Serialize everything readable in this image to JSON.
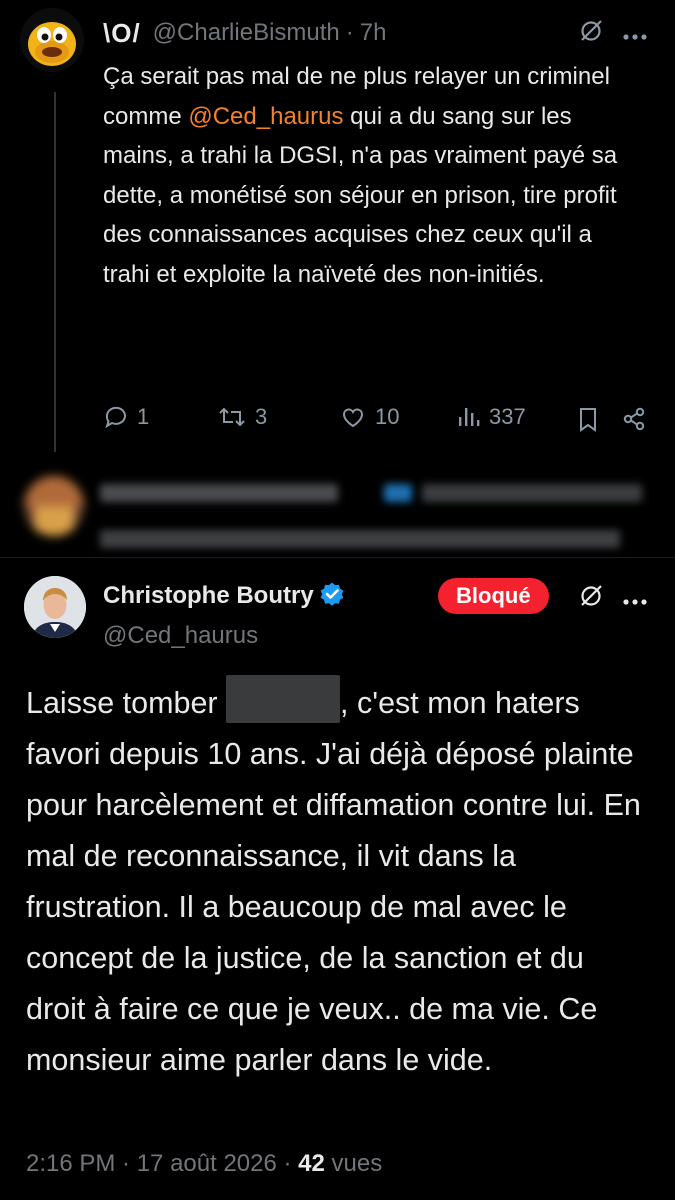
{
  "reply_tweet": {
    "display_name": "\\O/",
    "handle": "@CharlieBismuth",
    "separator": "·",
    "time": "7h",
    "text_before": "Ça serait pas mal de ne plus relayer un criminel comme ",
    "mention": "@Ced_haurus",
    "text_after": " qui a du sang sur les mains, a trahi la DGSI, n'a pas vraiment payé sa dette, a monétisé son séjour en prison, tire profit des connaissances acquises chez ceux qu'il a trahi et exploite la naïveté des non-initiés.",
    "stats": {
      "replies": "1",
      "reposts": "3",
      "likes": "10",
      "views": "337"
    },
    "icons": [
      "grok-icon",
      "more-icon",
      "reply-icon",
      "repost-icon",
      "like-icon",
      "views-icon",
      "bookmark-icon",
      "share-icon"
    ]
  },
  "main_tweet": {
    "display_name": "Christophe Boutry",
    "handle": "@Ced_haurus",
    "blocked_label": "Bloqué",
    "text_before": "Laisse tomber ",
    "text_after": ", c'est mon haters favori depuis 10 ans. J'ai déjà déposé plainte pour harcèlement et diffamation contre lui. En mal de reconnaissance, il vit dans la frustration. Il a beaucoup de mal avec le concept de la justice, de la sanction et du droit à faire ce que je veux.. de ma vie. Ce monsieur aime parler dans le vide.",
    "timestamp": "2:16 PM · 17 août 2026 · ",
    "views_count": "42",
    "views_label": " vues"
  },
  "colors": {
    "background": "#000000",
    "text": "#e7e9ea",
    "muted": "#71767b",
    "mention": "#f4812b",
    "verified": "#1d9bf0",
    "blocked_badge": "#f4212e"
  }
}
